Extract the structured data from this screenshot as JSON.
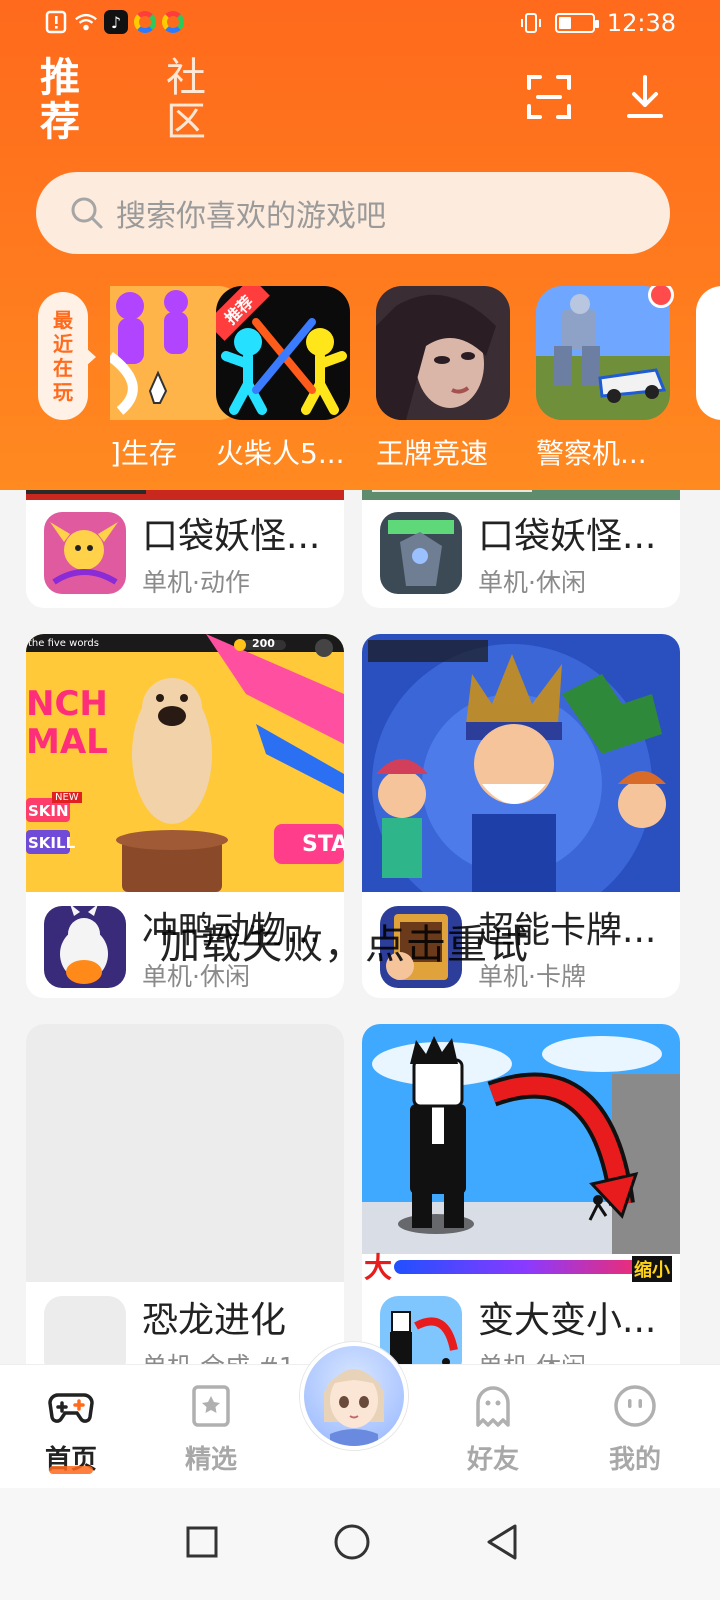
{
  "status_bar": {
    "time": "12:38",
    "battery_level": 0.35
  },
  "header": {
    "tabs": [
      {
        "label": "推荐",
        "active": true
      },
      {
        "label": "社区",
        "active": false
      }
    ],
    "search_placeholder": "搜索你喜欢的游戏吧",
    "recent_tab_label": "最近在玩",
    "recent_games": [
      {
        "label": "]生存"
      },
      {
        "label": "火柴人5...",
        "badge": "推荐"
      },
      {
        "label": "王牌竞速"
      },
      {
        "label": "警察机..."
      }
    ]
  },
  "cards": [
    {
      "title": "口袋妖怪...",
      "subtitle": "单机·动作"
    },
    {
      "title": "口袋妖怪...",
      "subtitle": "单机·休闲"
    },
    {
      "title": "冲鸭动物...",
      "subtitle": "单机·休闲",
      "banner_text": {
        "top": "the five words",
        "coins": "200",
        "left1": "NCH",
        "left2": "MAL",
        "btn1_tag": "NEW",
        "btn1": "SKIN",
        "btn2": "SKILL",
        "start": "STA"
      }
    },
    {
      "title": "超能卡牌...",
      "subtitle": "单机·卡牌"
    },
    {
      "title": "恐龙进化",
      "subtitle": "单机·合成 #1"
    },
    {
      "title": "变大变小...",
      "subtitle": "单机·休闲",
      "banner_text": {
        "big": "大",
        "small": "缩小"
      }
    }
  ],
  "toast": "加载失败，点击重试",
  "bottom_nav": [
    {
      "label": "首页",
      "active": true
    },
    {
      "label": "精选",
      "active": false
    },
    {
      "label": "好友",
      "active": false
    },
    {
      "label": "我的",
      "active": false
    }
  ],
  "colors": {
    "brand": "#ff6a1c",
    "search_bg": "#fdebdd"
  }
}
